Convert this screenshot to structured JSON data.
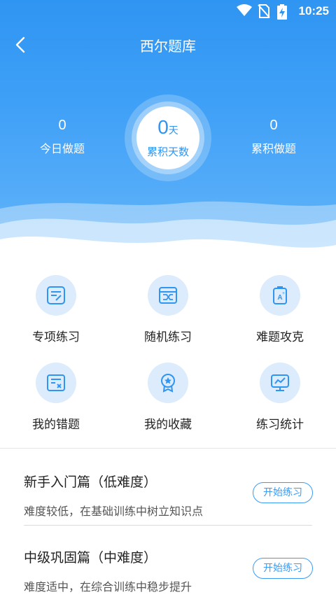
{
  "status_bar": {
    "time": "10:25",
    "icons": [
      "wifi-icon",
      "no-sim-icon",
      "battery-charging-icon"
    ]
  },
  "header": {
    "title": "西尔题库",
    "back_icon": "back-arrow-icon"
  },
  "stats": {
    "today": {
      "value": "0",
      "label": "今日做题"
    },
    "days": {
      "value": "0",
      "unit": "天",
      "label": "累积天数"
    },
    "total": {
      "value": "0",
      "label": "累积做题"
    }
  },
  "menu": [
    {
      "label": "专项练习",
      "icon": "edit-note-icon"
    },
    {
      "label": "随机练习",
      "icon": "shuffle-icon"
    },
    {
      "label": "难题攻克",
      "icon": "hard-question-icon"
    },
    {
      "label": "我的错题",
      "icon": "wrong-answer-icon"
    },
    {
      "label": "我的收藏",
      "icon": "favorite-badge-icon"
    },
    {
      "label": "练习统计",
      "icon": "statistics-icon"
    }
  ],
  "levels": [
    {
      "title": "新手入门篇（低难度）",
      "desc": "难度较低，在基础训练中树立知识点",
      "button": "开始练习"
    },
    {
      "title": "中级巩固篇（中难度）",
      "desc": "难度适中，在综合训练中稳步提升",
      "button": "开始练习"
    }
  ],
  "colors": {
    "primary": "#2f95f2",
    "icon_bg": "#dcecfc",
    "text": "#222222"
  }
}
